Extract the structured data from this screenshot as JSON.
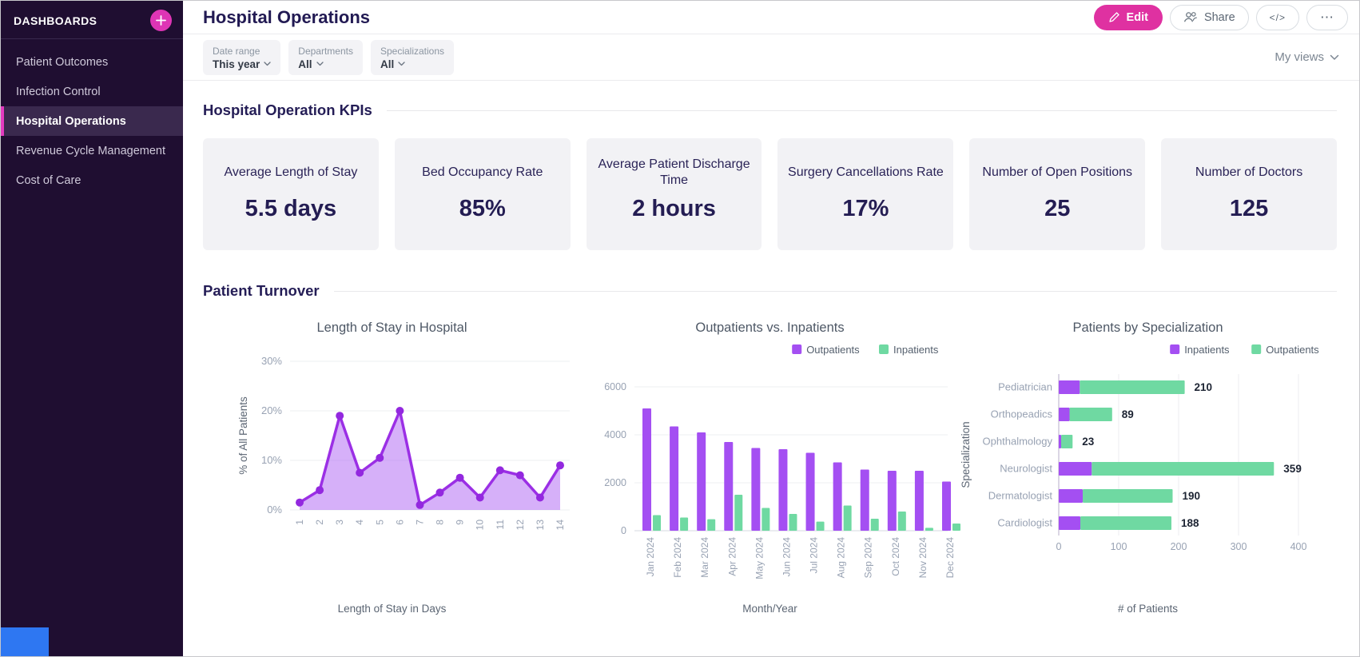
{
  "sidebar": {
    "title": "DASHBOARDS",
    "items": [
      {
        "label": "Patient Outcomes",
        "active": false
      },
      {
        "label": "Infection Control",
        "active": false
      },
      {
        "label": "Hospital Operations",
        "active": true
      },
      {
        "label": "Revenue Cycle Management",
        "active": false
      },
      {
        "label": "Cost of Care",
        "active": false
      }
    ]
  },
  "header": {
    "title": "Hospital Operations",
    "edit_label": "Edit",
    "share_label": "Share",
    "code_label": "</>",
    "more_label": "⋯"
  },
  "filters": {
    "chips": [
      {
        "label": "Date range",
        "value": "This year"
      },
      {
        "label": "Departments",
        "value": "All"
      },
      {
        "label": "Specializations",
        "value": "All"
      }
    ],
    "views_label": "My views"
  },
  "kpi_section": {
    "title": "Hospital Operation KPIs",
    "cards": [
      {
        "title": "Average Length of Stay",
        "value": "5.5 days"
      },
      {
        "title": "Bed Occupancy Rate",
        "value": "85%"
      },
      {
        "title": "Average Patient Discharge Time",
        "value": "2 hours"
      },
      {
        "title": "Surgery Cancellations Rate",
        "value": "17%"
      },
      {
        "title": "Number of Open Positions",
        "value": "25"
      },
      {
        "title": "Number of Doctors",
        "value": "125"
      }
    ]
  },
  "turnover_section": {
    "title": "Patient Turnover"
  },
  "colors": {
    "accent_pink": "#df31a1",
    "sidebar_bg": "#1f0e31",
    "purple": "#a44ff2",
    "green": "#6fd9a2"
  },
  "chart_data": [
    {
      "type": "area",
      "title": "Length of Stay in Hospital",
      "xlabel": "Length of Stay in Days",
      "ylabel": "% of All Patients",
      "x": [
        "1",
        "2",
        "3",
        "4",
        "5",
        "6",
        "7",
        "8",
        "9",
        "10",
        "11",
        "12",
        "13",
        "14"
      ],
      "values": [
        1.5,
        4,
        19,
        7.5,
        10.5,
        20,
        1,
        3.5,
        6.5,
        2.5,
        8,
        7,
        2.5,
        9
      ],
      "ylim": [
        0,
        30
      ],
      "yticks": [
        {
          "value": 0,
          "label": "0%"
        },
        {
          "value": 10,
          "label": "10%"
        },
        {
          "value": 20,
          "label": "20%"
        },
        {
          "value": 30,
          "label": "30%"
        }
      ],
      "color": "#a44ff2",
      "line_color": "#9b2fe5",
      "marker_color": "#9328df",
      "grid": true,
      "legend": []
    },
    {
      "type": "bar",
      "title": "Outpatients vs. Inpatients",
      "xlabel": "Month/Year",
      "categories": [
        "Jan 2024",
        "Feb 2024",
        "Mar 2024",
        "Apr 2024",
        "May 2024",
        "Jun 2024",
        "Jul 2024",
        "Aug 2024",
        "Sep 2024",
        "Oct 2024",
        "Nov 2024",
        "Dec 2024"
      ],
      "series": [
        {
          "name": "Outpatients",
          "color": "#a44ff2",
          "values": [
            5100,
            4350,
            4100,
            3700,
            3450,
            3400,
            3250,
            2850,
            2550,
            2500,
            2500,
            2050
          ]
        },
        {
          "name": "Inpatients",
          "color": "#6fd9a2",
          "values": [
            650,
            550,
            480,
            1500,
            950,
            700,
            380,
            1050,
            500,
            800,
            120,
            300
          ]
        }
      ],
      "ylim": [
        0,
        6000
      ],
      "yticks": [
        {
          "value": 0,
          "label": "0"
        },
        {
          "value": 2000,
          "label": "2000"
        },
        {
          "value": 4000,
          "label": "4000"
        },
        {
          "value": 6000,
          "label": "6000"
        }
      ],
      "grid": true,
      "legend_position": "top-right"
    },
    {
      "type": "stacked-horizontal-bar",
      "title": "Patients by Specialization",
      "xlabel": "# of Patients",
      "ylabel": "Specialization",
      "categories": [
        "Pediatrician",
        "Orthopeadics",
        "Ophthalmology",
        "Neurologist",
        "Dermatologist",
        "Cardiologist"
      ],
      "series": [
        {
          "name": "Inpatients",
          "color": "#a44ff2",
          "values": [
            35,
            18,
            4,
            55,
            40,
            36
          ]
        },
        {
          "name": "Outpatients",
          "color": "#6fd9a2",
          "values": [
            175,
            71,
            19,
            304,
            150,
            152
          ]
        }
      ],
      "totals": [
        210,
        89,
        23,
        359,
        190,
        188
      ],
      "xlim": [
        0,
        400
      ],
      "xticks": [
        {
          "value": 0,
          "label": "0"
        },
        {
          "value": 100,
          "label": "100"
        },
        {
          "value": 200,
          "label": "200"
        },
        {
          "value": 300,
          "label": "300"
        },
        {
          "value": 400,
          "label": "400"
        }
      ],
      "grid": true,
      "legend_position": "top-right"
    }
  ]
}
